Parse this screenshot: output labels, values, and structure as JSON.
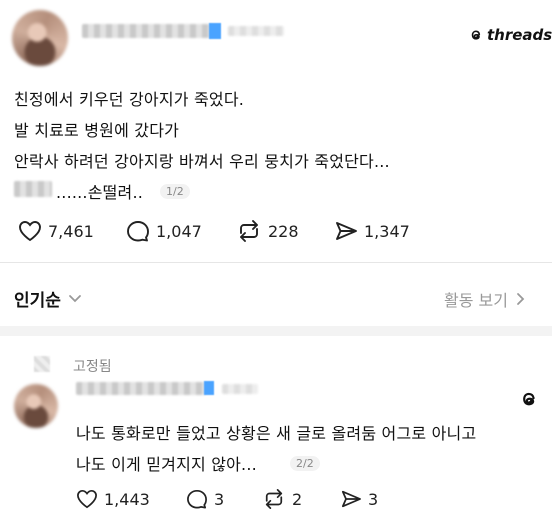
{
  "post": {
    "lines": [
      "친정에서 키우던 강아지가 죽었다.",
      "발 치료로 병원에 갔다가",
      "안락사 하려던 강아지랑 바껴서 우리 뭉치가 죽었단다..."
    ],
    "last_line": "......손떨려..",
    "pager": "1/2",
    "likes": "7,461",
    "comments": "1,047",
    "reposts": "228",
    "shares": "1,347"
  },
  "brand": {
    "label": "threads"
  },
  "sort": {
    "label": "인기순",
    "activity": "활동 보기"
  },
  "reply": {
    "pinned": "고정됨",
    "lines": [
      "나도 통화로만 들었고 상황은 새 글로 올려둠 어그로 아니고",
      "나도 이게 믿겨지지 않아..."
    ],
    "pager": "2/2",
    "likes": "1,443",
    "comments": "3",
    "reposts": "2",
    "shares": "3"
  },
  "icons": [
    "heart-icon",
    "comment-icon",
    "repost-icon",
    "share-icon",
    "threads-logo-icon",
    "chevron-down-icon",
    "chevron-right-icon"
  ],
  "colors": {
    "verified": "#4aa3ff",
    "text": "#111111",
    "muted": "#888888"
  }
}
